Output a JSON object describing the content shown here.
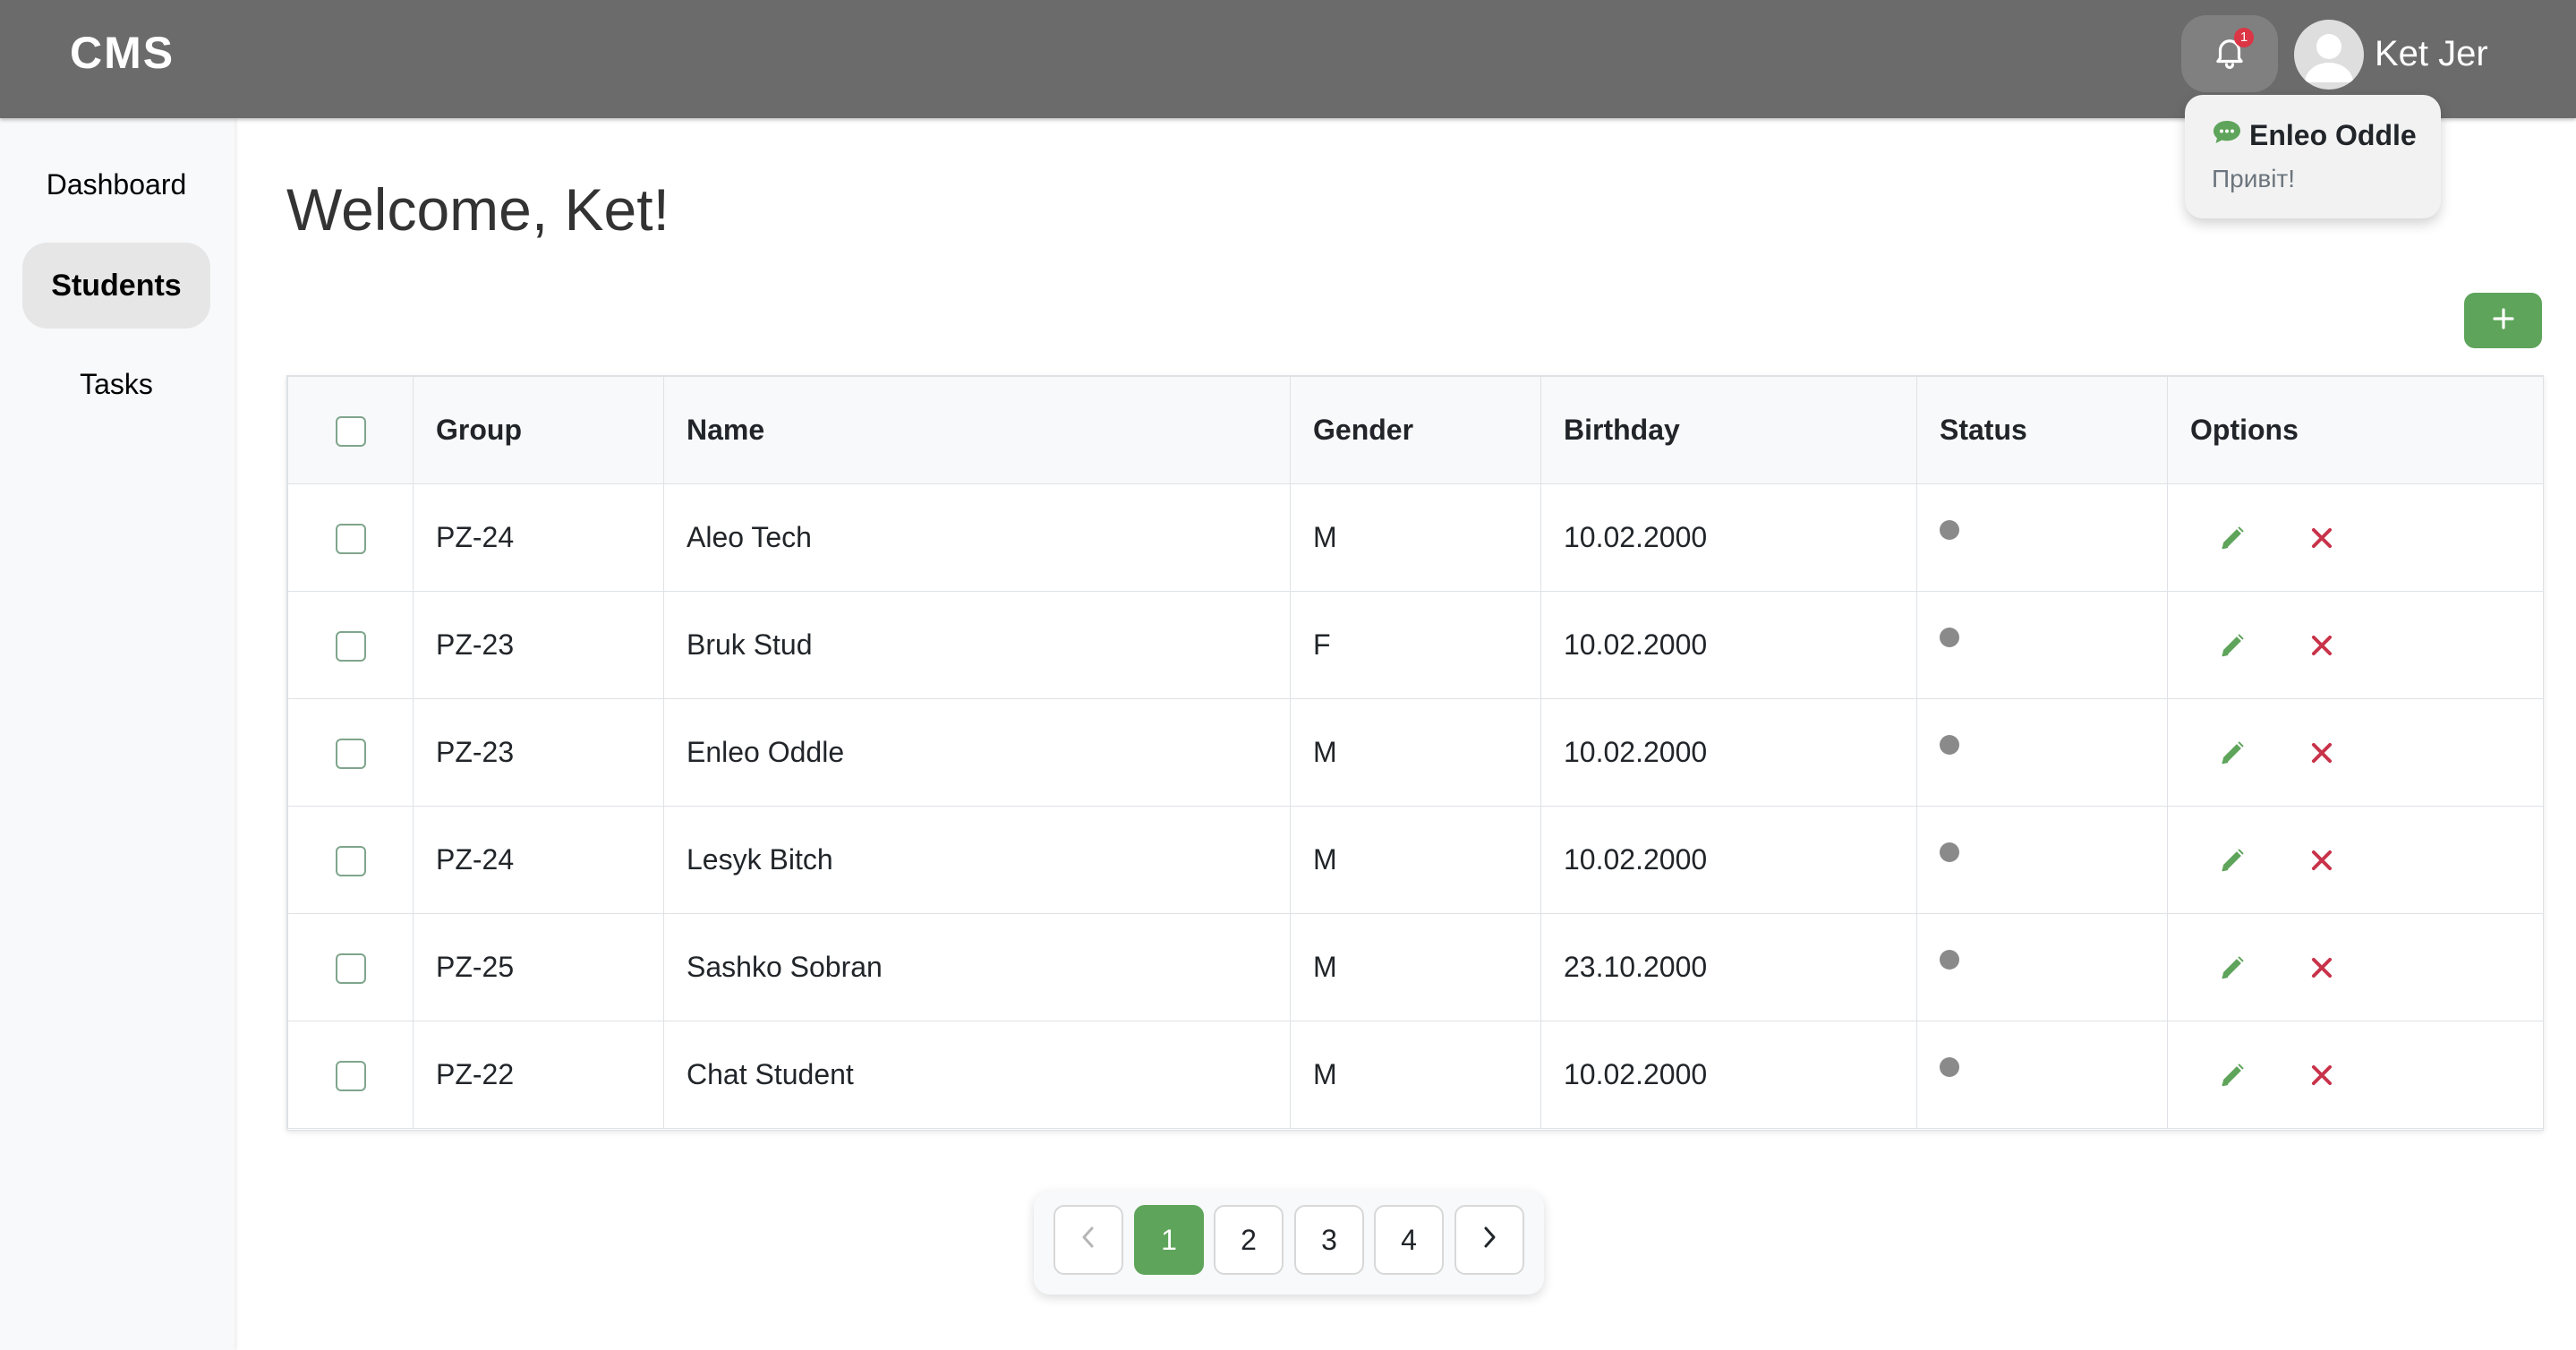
{
  "header": {
    "brand": "CMS",
    "notification_count": "1",
    "user_name": "Ket Jer"
  },
  "notification": {
    "sender": "Enleo Oddle",
    "message": "Привіт!"
  },
  "sidebar": {
    "items": [
      {
        "label": "Dashboard",
        "active": false
      },
      {
        "label": "Students",
        "active": true
      },
      {
        "label": "Tasks",
        "active": false
      }
    ]
  },
  "main": {
    "welcome": "Welcome, Ket!",
    "add_button_label": "+"
  },
  "table": {
    "headers": {
      "group": "Group",
      "name": "Name",
      "gender": "Gender",
      "birthday": "Birthday",
      "status": "Status",
      "options": "Options"
    },
    "rows": [
      {
        "group": "PZ-24",
        "name": "Aleo Tech",
        "gender": "M",
        "birthday": "10.02.2000"
      },
      {
        "group": "PZ-23",
        "name": "Bruk Stud",
        "gender": "F",
        "birthday": "10.02.2000"
      },
      {
        "group": "PZ-23",
        "name": "Enleo Oddle",
        "gender": "M",
        "birthday": "10.02.2000"
      },
      {
        "group": "PZ-24",
        "name": "Lesyk Bitch",
        "gender": "M",
        "birthday": "10.02.2000"
      },
      {
        "group": "PZ-25",
        "name": "Sashko Sobran",
        "gender": "M",
        "birthday": "23.10.2000"
      },
      {
        "group": "PZ-22",
        "name": "Chat Student",
        "gender": "M",
        "birthday": "10.02.2000"
      }
    ]
  },
  "pagination": {
    "pages": [
      "1",
      "2",
      "3",
      "4"
    ],
    "current": "1"
  },
  "colors": {
    "header_bg": "#6b6b6b",
    "accent_green": "#5ea45a",
    "delete_red": "#c8334a",
    "status_offline": "#8a8a8a"
  }
}
